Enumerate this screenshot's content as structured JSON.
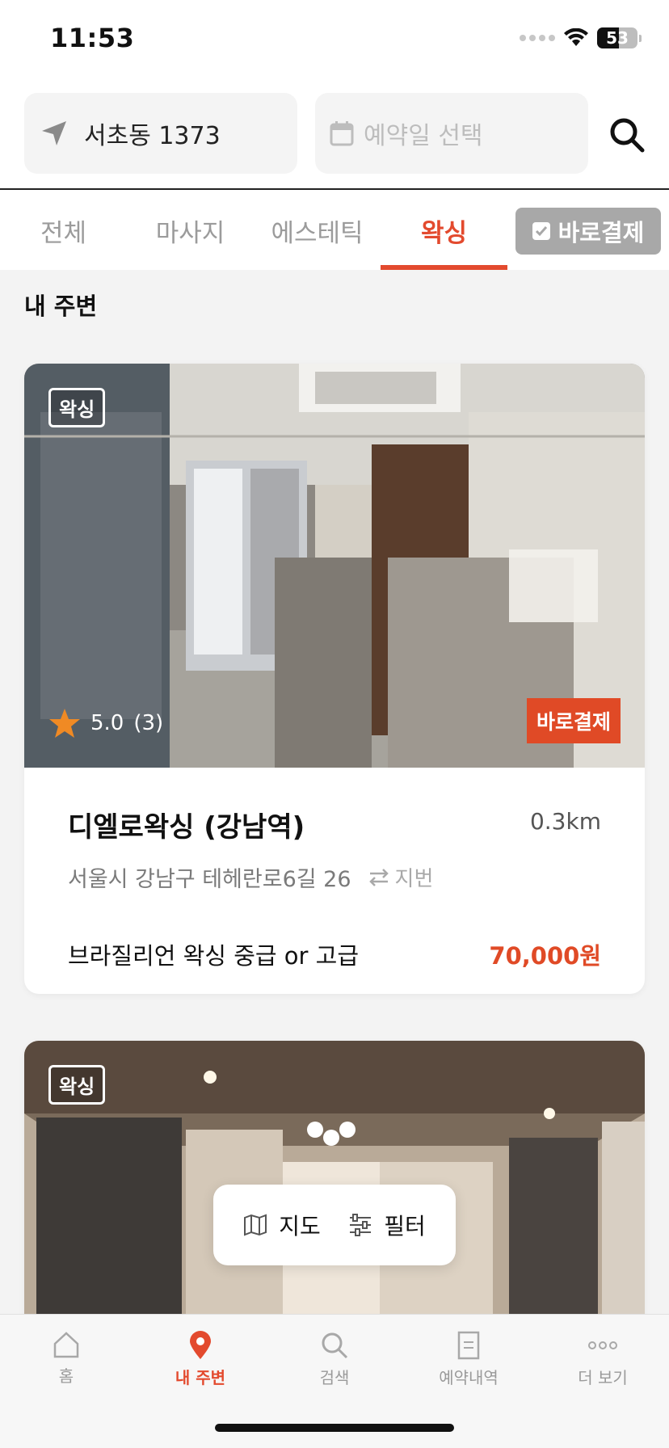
{
  "status": {
    "time": "11:53",
    "battery": "53",
    "battery_level_percent": 53
  },
  "search": {
    "location": "서초동 1373",
    "date_placeholder": "예약일 선택"
  },
  "tabs": [
    {
      "label": "전체",
      "active": false
    },
    {
      "label": "마사지",
      "active": false
    },
    {
      "label": "에스테틱",
      "active": false
    },
    {
      "label": "왁싱",
      "active": true
    }
  ],
  "direct_pay_toggle": {
    "label": "바로결제",
    "checked": true
  },
  "section": {
    "title": "내 주변"
  },
  "cards": [
    {
      "tag": "왁싱",
      "rating": "5.0",
      "review_count": "(3)",
      "badge": "바로결제",
      "name": "디엘로왁싱 (강남역)",
      "distance": "0.3km",
      "address": "서울시 강남구 테헤란로6길 26",
      "jibun_label": "지번",
      "service": "브라질리언 왁싱 중급 or 고급",
      "price": "70,000원"
    },
    {
      "tag": "왁싱"
    }
  ],
  "floating": {
    "map_label": "지도",
    "filter_label": "필터"
  },
  "bottom_nav": [
    {
      "label": "홈",
      "icon": "home-icon",
      "active": false
    },
    {
      "label": "내 주변",
      "icon": "location-pin-icon",
      "active": true
    },
    {
      "label": "검색",
      "icon": "search-icon",
      "active": false
    },
    {
      "label": "예약내역",
      "icon": "document-icon",
      "active": false
    },
    {
      "label": "더 보기",
      "icon": "more-icon",
      "active": false
    }
  ],
  "colors": {
    "accent": "#e34a2e",
    "price": "#e04a26",
    "muted": "#9b9b9b"
  }
}
